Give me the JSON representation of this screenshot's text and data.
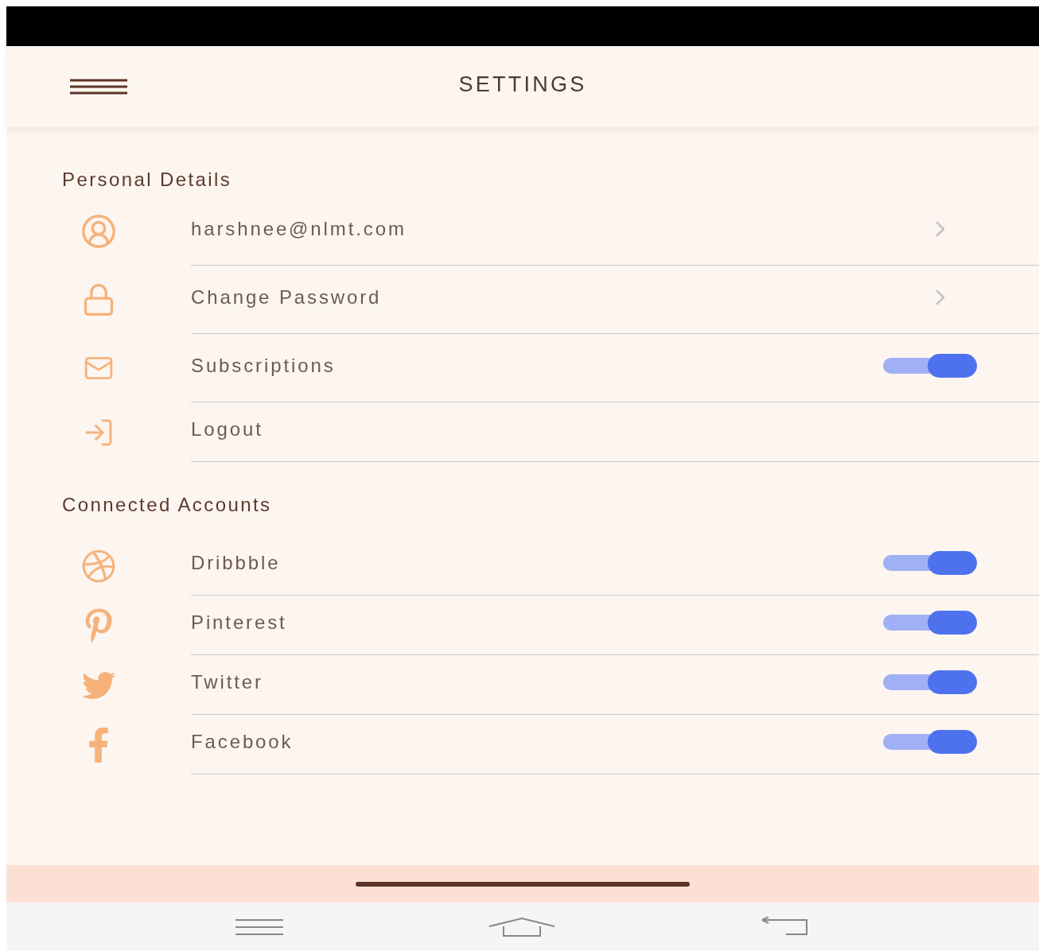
{
  "header": {
    "title": "SETTINGS"
  },
  "sections": [
    {
      "title": "Personal Details",
      "items": [
        {
          "kind": "link",
          "label": "harshnee@nlmt.com"
        },
        {
          "kind": "link",
          "label": "Change Password"
        },
        {
          "kind": "toggle",
          "label": "Subscriptions",
          "on": true
        },
        {
          "kind": "plain",
          "label": "Logout"
        }
      ]
    },
    {
      "title": "Connected Accounts",
      "items": [
        {
          "kind": "toggle",
          "label": "Dribbble",
          "on": true
        },
        {
          "kind": "toggle",
          "label": "Pinterest",
          "on": true
        },
        {
          "kind": "toggle",
          "label": "Twitter",
          "on": true
        },
        {
          "kind": "toggle",
          "label": "Facebook",
          "on": true
        }
      ]
    }
  ]
}
